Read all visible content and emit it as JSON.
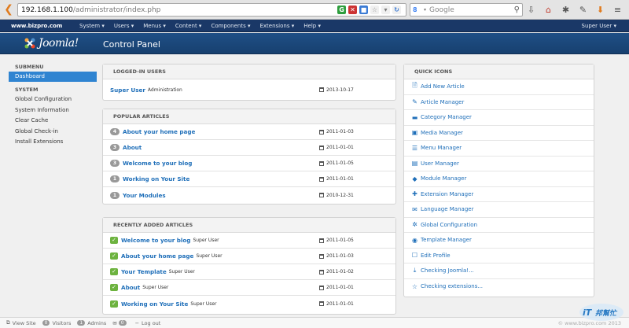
{
  "browser": {
    "url_host": "192.168.1.100",
    "url_path": "/administrator/index.php",
    "search_placeholder": "Google"
  },
  "topnav": {
    "site": "www.bizpro.com",
    "menu": [
      "System",
      "Users",
      "Menus",
      "Content",
      "Components",
      "Extensions",
      "Help"
    ],
    "user": "Super User"
  },
  "header": {
    "logo_text": "Joomla!",
    "page_title": "Control Panel"
  },
  "sidebar": {
    "submenu_heading": "SUBMENU",
    "active": "Dashboard",
    "system_heading": "SYSTEM",
    "items": [
      "Global Configuration",
      "System Information",
      "Clear Cache",
      "Global Check-in",
      "Install Extensions"
    ]
  },
  "logged_in": {
    "title": "LOGGED-IN USERS",
    "rows": [
      {
        "name": "Super User",
        "role": "Administration",
        "date": "2013-10-17"
      }
    ]
  },
  "popular": {
    "title": "POPULAR ARTICLES",
    "rows": [
      {
        "hits": "4",
        "title": "About your home page",
        "date": "2011-01-03"
      },
      {
        "hits": "3",
        "title": "About",
        "date": "2011-01-01"
      },
      {
        "hits": "3",
        "title": "Welcome to your blog",
        "date": "2011-01-05"
      },
      {
        "hits": "1",
        "title": "Working on Your Site",
        "date": "2011-01-01"
      },
      {
        "hits": "1",
        "title": "Your Modules",
        "date": "2010-12-31"
      }
    ]
  },
  "recent": {
    "title": "RECENTLY ADDED ARTICLES",
    "rows": [
      {
        "title": "Welcome to your blog",
        "author": "Super User",
        "date": "2011-01-05"
      },
      {
        "title": "About your home page",
        "author": "Super User",
        "date": "2011-01-03"
      },
      {
        "title": "Your Template",
        "author": "Super User",
        "date": "2011-01-02"
      },
      {
        "title": "About",
        "author": "Super User",
        "date": "2011-01-01"
      },
      {
        "title": "Working on Your Site",
        "author": "Super User",
        "date": "2011-01-01"
      }
    ]
  },
  "quick_icons": {
    "title": "QUICK ICONS",
    "items": [
      {
        "label": "Add New Article",
        "icon": "new-article-icon"
      },
      {
        "label": "Article Manager",
        "icon": "pencil-icon"
      },
      {
        "label": "Category Manager",
        "icon": "folder-icon"
      },
      {
        "label": "Media Manager",
        "icon": "image-icon"
      },
      {
        "label": "Menu Manager",
        "icon": "list-icon"
      },
      {
        "label": "User Manager",
        "icon": "user-icon"
      },
      {
        "label": "Module Manager",
        "icon": "cube-icon"
      },
      {
        "label": "Extension Manager",
        "icon": "puzzle-icon"
      },
      {
        "label": "Language Manager",
        "icon": "comment-icon"
      },
      {
        "label": "Global Configuration",
        "icon": "gear-icon"
      },
      {
        "label": "Template Manager",
        "icon": "eye-icon"
      },
      {
        "label": "Edit Profile",
        "icon": "edit-icon"
      },
      {
        "label": "Checking Joomla!...",
        "icon": "download-icon"
      },
      {
        "label": "Checking extensions...",
        "icon": "star-icon"
      }
    ]
  },
  "status": {
    "view_site": "View Site",
    "visitors_count": "0",
    "visitors": "Visitors",
    "admins_count": "1",
    "admins": "Admins",
    "messages_count": "0",
    "logout": "Log out",
    "copyright": "© www.bizpro.com 2013"
  },
  "colors": {
    "nav": "#1a3867",
    "header": "#1f4f86",
    "link": "#1f6fb9",
    "active": "#2f84d1",
    "check": "#6db33f"
  }
}
